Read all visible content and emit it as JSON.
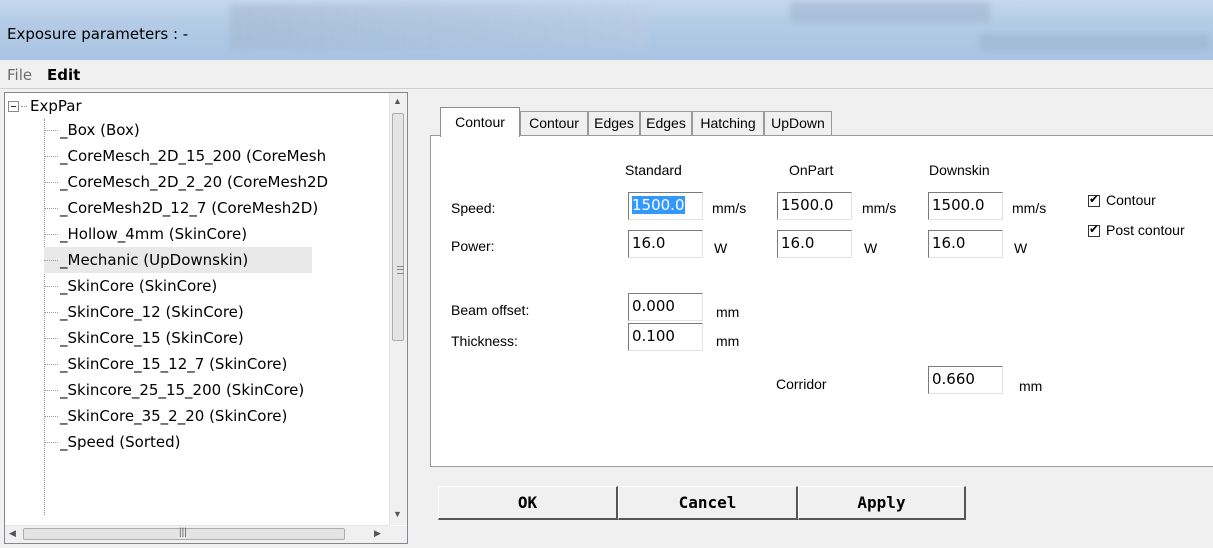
{
  "window": {
    "title": "Exposure parameters :  -"
  },
  "menu": {
    "file": "File",
    "edit": "Edit"
  },
  "tree": {
    "root": "ExpPar",
    "items": [
      "_Box (Box)",
      "_CoreMesch_2D_15_200 (CoreMesh",
      "_CoreMesch_2D_2_20 (CoreMesh2D",
      "_CoreMesh2D_12_7 (CoreMesh2D)",
      "_Hollow_4mm (SkinCore)",
      "_Mechanic (UpDownskin)",
      "_SkinCore (SkinCore)",
      "_SkinCore_12 (SkinCore)",
      "_SkinCore_15 (SkinCore)",
      "_SkinCore_15_12_7 (SkinCore)",
      "_Skincore_25_15_200 (SkinCore)",
      "_SkinCore_35_2_20 (SkinCore)",
      "_Speed (Sorted)"
    ],
    "selected_index": 5
  },
  "tabs": [
    "Contour",
    "Contour",
    "Edges",
    "Edges",
    "Hatching",
    "UpDown"
  ],
  "form": {
    "col_standard": "Standard",
    "col_onpart": "OnPart",
    "col_downskin": "Downskin",
    "speed_label": "Speed:",
    "power_label": "Power:",
    "speed_standard": "1500.0",
    "speed_onpart": "1500.0",
    "speed_downskin": "1500.0",
    "power_standard": "16.0",
    "power_onpart": "16.0",
    "power_downskin": "16.0",
    "unit_speed": "mm/s",
    "unit_power": "W",
    "unit_mm": "mm",
    "contour_checkbox": "Contour",
    "contour_checked": true,
    "post_contour_checkbox": "Post contour",
    "post_contour_checked": true,
    "beam_offset_label": "Beam offset:",
    "beam_offset": "0.000",
    "thickness_label": "Thickness:",
    "thickness": "0.100",
    "corridor_label": "Corridor",
    "corridor": "0.660"
  },
  "buttons": {
    "ok": "OK",
    "cancel": "Cancel",
    "apply": "Apply"
  }
}
